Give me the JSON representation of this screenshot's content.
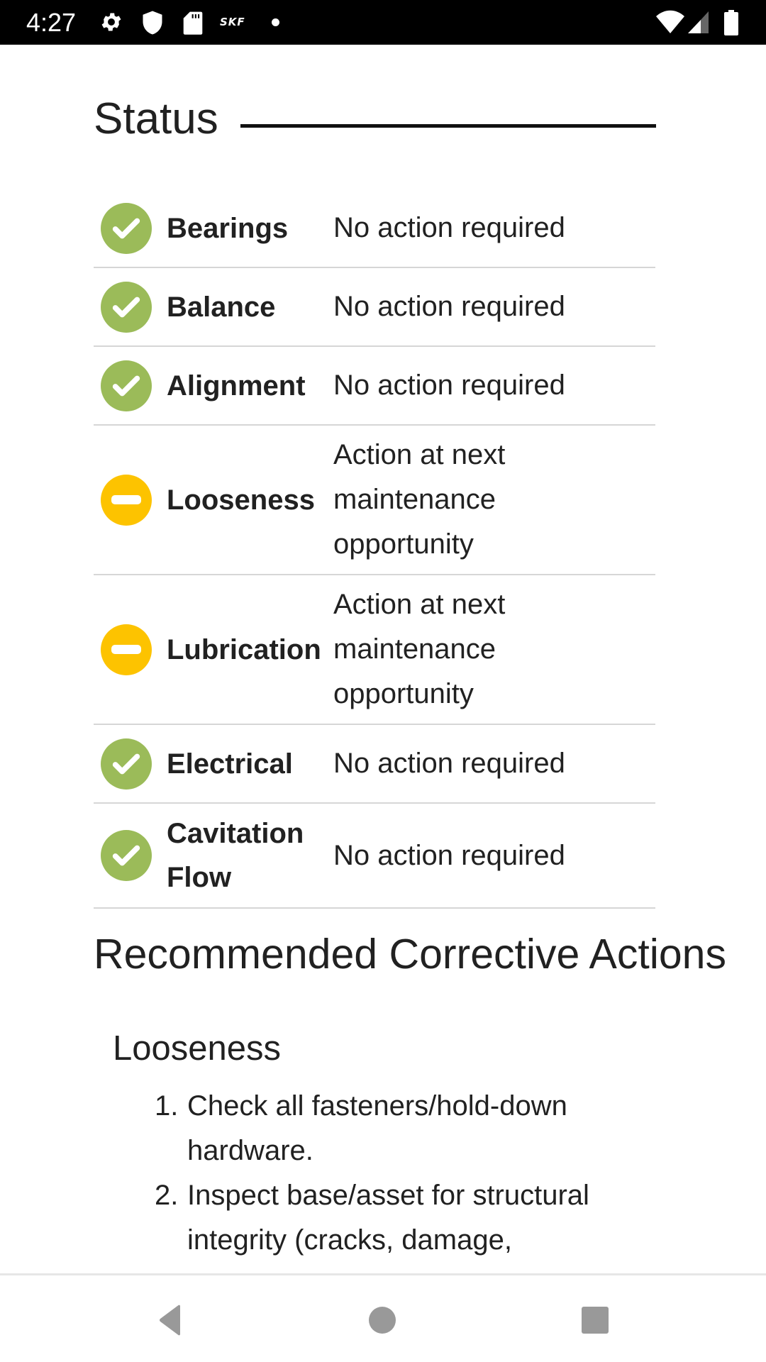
{
  "status_bar": {
    "time": "4:27",
    "left_icons": [
      "gear-icon",
      "shield-icon",
      "sd-card-icon",
      "skf-logo",
      "notification-dot"
    ],
    "skf_text": "SKF",
    "right_icons": [
      "wifi-icon",
      "cell-signal-icon",
      "battery-icon"
    ]
  },
  "status": {
    "title": "Status",
    "rows": [
      {
        "label": "Bearings",
        "value": "No action required",
        "state": "ok"
      },
      {
        "label": "Balance",
        "value": "No action required",
        "state": "ok"
      },
      {
        "label": "Alignment",
        "value": "No action required",
        "state": "ok"
      },
      {
        "label": "Looseness",
        "value": "Action at next maintenance opportunity",
        "state": "warning"
      },
      {
        "label": "Lubrication",
        "value": "Action at next maintenance opportunity",
        "state": "warning"
      },
      {
        "label": "Electrical",
        "value": "No action required",
        "state": "ok"
      },
      {
        "label": "Cavitation Flow",
        "value": "No action required",
        "state": "ok"
      }
    ],
    "colors": {
      "ok": "#9bbb59",
      "warning": "#fdc300"
    }
  },
  "recommended": {
    "title": "Recommended Corrective Actions",
    "sections": [
      {
        "heading": "Looseness",
        "items": [
          {
            "num": "1.",
            "text": "Check all fasteners/hold-down hardware."
          },
          {
            "num": "2.",
            "text": "Inspect base/asset for structural integrity (cracks, damage,"
          }
        ]
      }
    ]
  },
  "nav_bar": {
    "buttons": [
      "back",
      "home",
      "recents"
    ]
  }
}
